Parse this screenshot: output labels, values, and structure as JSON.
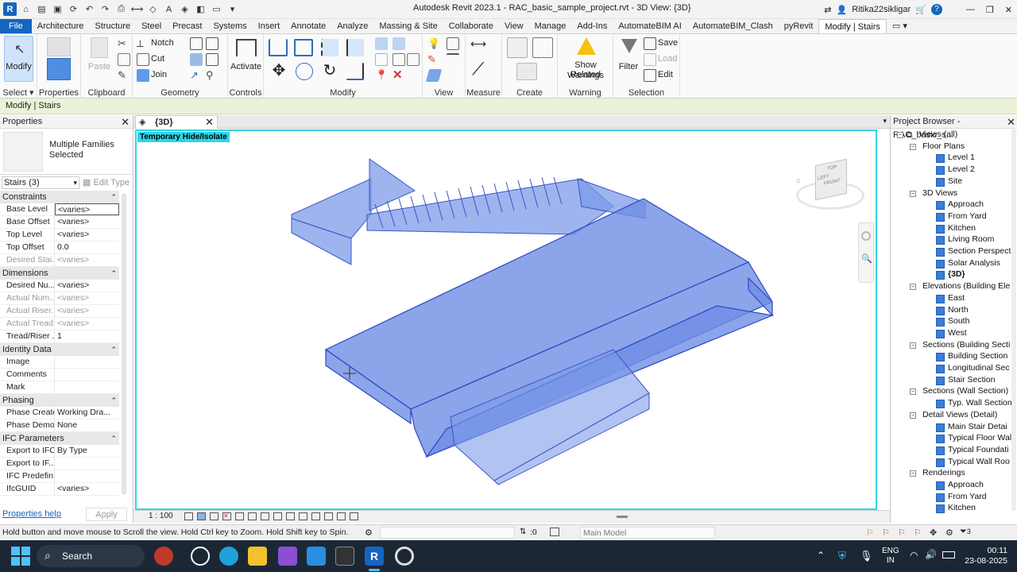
{
  "app": {
    "title": "Autodesk Revit 2023.1 - RAC_basic_sample_project.rvt - 3D View: {3D}",
    "user": "Ritika22sikligar"
  },
  "tabs": [
    "File",
    "Architecture",
    "Structure",
    "Steel",
    "Precast",
    "Systems",
    "Insert",
    "Annotate",
    "Analyze",
    "Massing & Site",
    "Collaborate",
    "View",
    "Manage",
    "Add-Ins",
    "AutomateBIM AI",
    "AutomateBIM_Clash",
    "pyRevit",
    "Modify | Stairs"
  ],
  "ribbon": {
    "modify": "Modify",
    "paste": "Paste",
    "notch": "Notch",
    "cut": "Cut",
    "join": "Join",
    "activate": "Activate",
    "show_related": "Show Related",
    "warnings": "Warnings",
    "filter": "Filter",
    "save": "Save",
    "load": "Load",
    "edit": "Edit",
    "panels": {
      "select": "Select",
      "properties": "Properties",
      "clipboard": "Clipboard",
      "geometry": "Geometry",
      "controls": "Controls",
      "modify": "Modify",
      "view": "View",
      "measure": "Measure",
      "create": "Create",
      "warning": "Warning",
      "selection": "Selection"
    }
  },
  "context_bar": "Modify | Stairs",
  "properties": {
    "title": "Properties",
    "type_name": "Multiple Families Selected",
    "selector": "Stairs (3)",
    "edit_type": "Edit Type",
    "sections": [
      {
        "name": "Constraints",
        "rows": [
          [
            "Base Level",
            "<varies>",
            false
          ],
          [
            "Base Offset",
            "<varies>",
            false
          ],
          [
            "Top Level",
            "<varies>",
            false
          ],
          [
            "Top Offset",
            "0.0",
            false
          ],
          [
            "Desired Stai...",
            "<varies>",
            true
          ]
        ]
      },
      {
        "name": "Dimensions",
        "rows": [
          [
            "Desired Nu...",
            "<varies>",
            false
          ],
          [
            "Actual Num...",
            "<varies>",
            true
          ],
          [
            "Actual Riser...",
            "<varies>",
            true
          ],
          [
            "Actual Tread...",
            "<varies>",
            true
          ],
          [
            "Tread/Riser ...",
            "1",
            false
          ]
        ]
      },
      {
        "name": "Identity Data",
        "rows": [
          [
            "Image",
            "",
            false
          ],
          [
            "Comments",
            "",
            false
          ],
          [
            "Mark",
            "",
            false
          ]
        ]
      },
      {
        "name": "Phasing",
        "rows": [
          [
            "Phase Created",
            "Working Dra...",
            false
          ],
          [
            "Phase Demo...",
            "None",
            false
          ]
        ]
      },
      {
        "name": "IFC Parameters",
        "rows": [
          [
            "Export to IFC",
            "By Type",
            false
          ],
          [
            "Export to IF...",
            "",
            false
          ],
          [
            "IFC Predefin...",
            "",
            false
          ],
          [
            "IfcGUID",
            "<varies>",
            false
          ]
        ]
      }
    ],
    "help_link": "Properties help",
    "apply": "Apply"
  },
  "view": {
    "tab": "{3D}",
    "temp_banner": "Temporary Hide/Isolate",
    "scale": "1 : 100",
    "cube_top": "TOP",
    "cube_left": "LEFT",
    "cube_front": "FRONT"
  },
  "browser": {
    "title": "Project Browser - RAC_basic_s...",
    "items": [
      {
        "label": "Views (all)",
        "level": 0,
        "expander": "−"
      },
      {
        "label": "Floor Plans",
        "level": 1,
        "expander": "−"
      },
      {
        "label": "Level 1",
        "level": 2
      },
      {
        "label": "Level 2",
        "level": 2
      },
      {
        "label": "Site",
        "level": 2
      },
      {
        "label": "3D Views",
        "level": 1,
        "expander": "−"
      },
      {
        "label": "Approach",
        "level": 2
      },
      {
        "label": "From Yard",
        "level": 2
      },
      {
        "label": "Kitchen",
        "level": 2
      },
      {
        "label": "Living Room",
        "level": 2
      },
      {
        "label": "Section Perspecti",
        "level": 2
      },
      {
        "label": "Solar Analysis",
        "level": 2
      },
      {
        "label": "{3D}",
        "level": 2,
        "bold": true
      },
      {
        "label": "Elevations (Building Ele",
        "level": 1,
        "expander": "−"
      },
      {
        "label": "East",
        "level": 2
      },
      {
        "label": "North",
        "level": 2
      },
      {
        "label": "South",
        "level": 2
      },
      {
        "label": "West",
        "level": 2
      },
      {
        "label": "Sections (Building Secti",
        "level": 1,
        "expander": "−"
      },
      {
        "label": "Building Section",
        "level": 2
      },
      {
        "label": "Longitudinal Sec",
        "level": 2
      },
      {
        "label": "Stair Section",
        "level": 2
      },
      {
        "label": "Sections (Wall Section)",
        "level": 1,
        "expander": "−"
      },
      {
        "label": "Typ. Wall Section",
        "level": 2
      },
      {
        "label": "Detail Views (Detail)",
        "level": 1,
        "expander": "−"
      },
      {
        "label": "Main Stair Detai",
        "level": 2
      },
      {
        "label": "Typical Floor Wal",
        "level": 2
      },
      {
        "label": "Typical Foundati",
        "level": 2
      },
      {
        "label": "Typical Wall Roo",
        "level": 2
      },
      {
        "label": "Renderings",
        "level": 1,
        "expander": "−"
      },
      {
        "label": "Approach",
        "level": 2
      },
      {
        "label": "From Yard",
        "level": 2
      },
      {
        "label": "Kitchen",
        "level": 2
      }
    ]
  },
  "status": {
    "message": "Hold button and move mouse to Scroll the view. Hold Ctrl key to Zoom. Hold Shift key to Spin.",
    "count": ":0",
    "model": "Main Model",
    "filter_count": "3"
  },
  "taskbar": {
    "search": "Search",
    "lang1": "ENG",
    "lang2": "IN",
    "time": "00:11",
    "date": "23-08-2025"
  }
}
